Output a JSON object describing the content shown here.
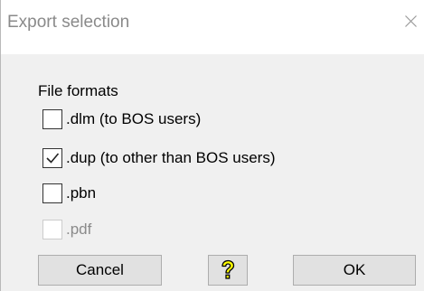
{
  "window": {
    "title": "Export selection"
  },
  "formats": {
    "label": "File formats",
    "options": [
      {
        "label": ".dlm (to BOS users)",
        "checked": false,
        "enabled": true
      },
      {
        "label": ".dup (to other than BOS users)",
        "checked": true,
        "enabled": true
      },
      {
        "label": ".pbn",
        "checked": false,
        "enabled": true
      },
      {
        "label": ".pdf",
        "checked": false,
        "enabled": false
      }
    ]
  },
  "buttons": {
    "cancel": "Cancel",
    "ok": "OK",
    "help_icon": "question-mark-icon"
  },
  "colors": {
    "help_icon_fill": "#ffff00",
    "dialog_background": "#f0f0f0"
  }
}
